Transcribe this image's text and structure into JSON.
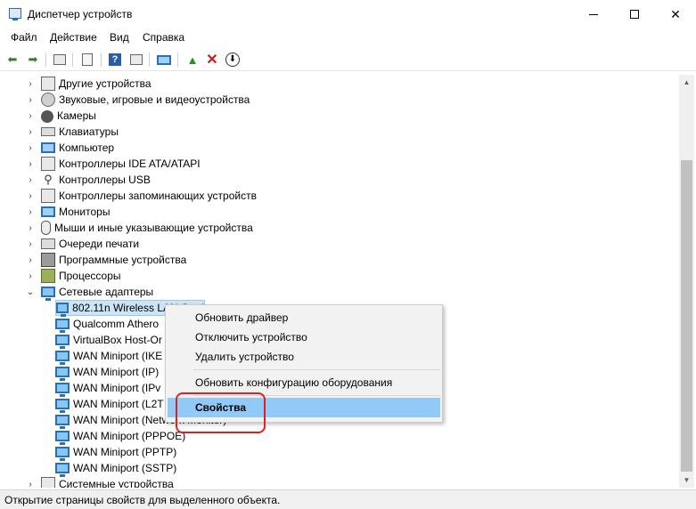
{
  "window": {
    "title": "Диспетчер устройств",
    "controls": [
      "minimize",
      "maximize",
      "close"
    ]
  },
  "menu": [
    "Файл",
    "Действие",
    "Вид",
    "Справка"
  ],
  "toolbar": {
    "icons": [
      "back-arrow-icon",
      "forward-arrow-icon",
      "show-hide-tree-icon",
      "properties-icon",
      "help-icon",
      "run-icon",
      "monitor-scan-icon",
      "update-driver-icon",
      "uninstall-x-icon",
      "download-icon"
    ],
    "accent_delete": "#d01818"
  },
  "tree": {
    "categories": [
      {
        "label": "Другие устройства",
        "icon": "generic-device-icon",
        "expanded": false
      },
      {
        "label": "Звуковые, игровые и видеоустройства",
        "icon": "speaker-icon",
        "expanded": false
      },
      {
        "label": "Камеры",
        "icon": "camera-icon",
        "expanded": false
      },
      {
        "label": "Клавиатуры",
        "icon": "keyboard-icon",
        "expanded": false
      },
      {
        "label": "Компьютер",
        "icon": "computer-icon",
        "expanded": false
      },
      {
        "label": "Контроллеры IDE ATA/ATAPI",
        "icon": "ide-controller-icon",
        "expanded": false
      },
      {
        "label": "Контроллеры USB",
        "icon": "usb-icon",
        "expanded": false
      },
      {
        "label": "Контроллеры запоминающих устройств",
        "icon": "storage-controller-icon",
        "expanded": false
      },
      {
        "label": "Мониторы",
        "icon": "monitor-icon",
        "expanded": false
      },
      {
        "label": "Мыши и иные указывающие устройства",
        "icon": "mouse-icon",
        "expanded": false
      },
      {
        "label": "Очереди печати",
        "icon": "printer-icon",
        "expanded": false
      },
      {
        "label": "Программные устройства",
        "icon": "software-device-icon",
        "expanded": false
      },
      {
        "label": "Процессоры",
        "icon": "processor-icon",
        "expanded": false
      },
      {
        "label": "Сетевые адаптеры",
        "icon": "network-adapter-icon",
        "expanded": true
      }
    ],
    "network_children": [
      "802.11n Wireless LAN Card",
      "Qualcomm Athero",
      "VirtualBox Host-Or",
      "WAN Miniport (IKE",
      "WAN Miniport (IP)",
      "WAN Miniport (IPv",
      "WAN Miniport (L2T",
      "WAN Miniport (Network Monitor)",
      "WAN Miniport (PPPOE)",
      "WAN Miniport (PPTP)",
      "WAN Miniport (SSTP)"
    ],
    "last_category": {
      "label": "Системные устройства",
      "icon": "system-device-icon",
      "expanded": false
    }
  },
  "context_menu": {
    "items": [
      "Обновить драйвер",
      "Отключить устройство",
      "Удалить устройство",
      "Обновить конфигурацию оборудования",
      "Свойства"
    ],
    "highlighted": "Свойства",
    "highlight_color": "#e11f1f"
  },
  "status": {
    "text": "Открытие страницы свойств для выделенного объекта."
  }
}
